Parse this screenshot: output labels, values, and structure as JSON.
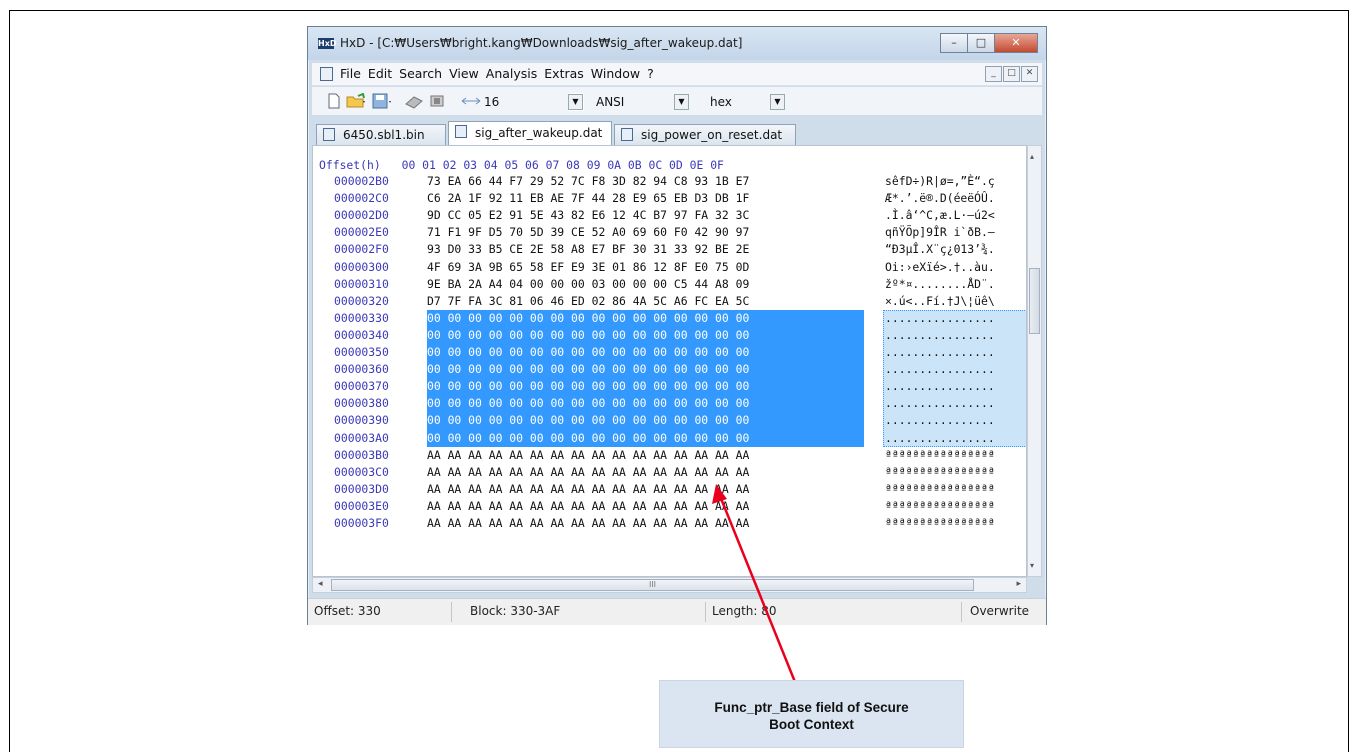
{
  "window": {
    "title": "HxD - [C:₩Users₩bright.kang₩Downloads₩sig_after_wakeup.dat]",
    "app_icon_label": "HxD",
    "controls": {
      "minimize": "–",
      "maximize": "□",
      "close": "✕"
    }
  },
  "menu": {
    "items": [
      "File",
      "Edit",
      "Search",
      "View",
      "Analysis",
      "Extras",
      "Window",
      "?"
    ],
    "mdi_controls": [
      "_",
      "□",
      "✕"
    ]
  },
  "toolbar": {
    "bytes_per_row": "16",
    "charset": "ANSI",
    "offset_base": "hex",
    "icons": [
      "new-file-icon",
      "open-file-icon",
      "save-icon",
      "disk-icon",
      "ram-icon",
      "bytes-per-row-icon"
    ]
  },
  "tabs": [
    {
      "label": "6450.sbl1.bin",
      "active": false
    },
    {
      "label": "sig_after_wakeup.dat",
      "active": true
    },
    {
      "label": "sig_power_on_reset.dat",
      "active": false
    }
  ],
  "editor": {
    "header_label": "Offset(h)",
    "columns": [
      "00",
      "01",
      "02",
      "03",
      "04",
      "05",
      "06",
      "07",
      "08",
      "09",
      "0A",
      "0B",
      "0C",
      "0D",
      "0E",
      "0F"
    ],
    "rows": [
      {
        "offset": "000002B0",
        "hex": "73 EA 66 44 F7 29 52 7C F8 3D 82 94 C8 93 1B E7",
        "ascii": "sêfD÷)R|ø=,”È“.ç",
        "selected": false
      },
      {
        "offset": "000002C0",
        "hex": "C6 2A 1F 92 11 EB AE 7F 44 28 E9 65 EB D3 DB 1F",
        "ascii": "Æ*.’.ë®.D(éeëÓÛ.",
        "selected": false
      },
      {
        "offset": "000002D0",
        "hex": "9D CC 05 E2 91 5E 43 82 E6 12 4C B7 97 FA 32 3C",
        "ascii": ".Ì.â‘^C,æ.L·—ú2<",
        "selected": false
      },
      {
        "offset": "000002E0",
        "hex": "71 F1 9F D5 70 5D 39 CE 52 A0 69 60 F0 42 90 97",
        "ascii": "qñŸÕp]9ÎR i`ðB.—",
        "selected": false
      },
      {
        "offset": "000002F0",
        "hex": "93 D0 33 B5 CE 2E 58 A8 E7 BF 30 31 33 92 BE 2E",
        "ascii": "“Ð3µÎ.X¨ç¿013’¾.",
        "selected": false
      },
      {
        "offset": "00000300",
        "hex": "4F 69 3A 9B 65 58 EF E9 3E 01 86 12 8F E0 75 0D",
        "ascii": "Oi:›eXïé>.†..àu.",
        "selected": false
      },
      {
        "offset": "00000310",
        "hex": "9E BA 2A A4 04 00 00 00 03 00 00 00 C5 44 A8 09",
        "ascii": "žº*¤........ÅD¨.",
        "selected": false
      },
      {
        "offset": "00000320",
        "hex": "D7 7F FA 3C 81 06 46 ED 02 86 4A 5C A6 FC EA 5C",
        "ascii": "×.ú<..Fí.†J\\¦üê\\",
        "selected": false
      },
      {
        "offset": "00000330",
        "hex": "00 00 00 00 00 00 00 00 00 00 00 00 00 00 00 00",
        "ascii": "................",
        "selected": true
      },
      {
        "offset": "00000340",
        "hex": "00 00 00 00 00 00 00 00 00 00 00 00 00 00 00 00",
        "ascii": "................",
        "selected": true
      },
      {
        "offset": "00000350",
        "hex": "00 00 00 00 00 00 00 00 00 00 00 00 00 00 00 00",
        "ascii": "................",
        "selected": true
      },
      {
        "offset": "00000360",
        "hex": "00 00 00 00 00 00 00 00 00 00 00 00 00 00 00 00",
        "ascii": "................",
        "selected": true
      },
      {
        "offset": "00000370",
        "hex": "00 00 00 00 00 00 00 00 00 00 00 00 00 00 00 00",
        "ascii": "................",
        "selected": true
      },
      {
        "offset": "00000380",
        "hex": "00 00 00 00 00 00 00 00 00 00 00 00 00 00 00 00",
        "ascii": "................",
        "selected": true
      },
      {
        "offset": "00000390",
        "hex": "00 00 00 00 00 00 00 00 00 00 00 00 00 00 00 00",
        "ascii": "................",
        "selected": true
      },
      {
        "offset": "000003A0",
        "hex": "00 00 00 00 00 00 00 00 00 00 00 00 00 00 00 00",
        "ascii": "................",
        "selected": true
      },
      {
        "offset": "000003B0",
        "hex": "AA AA AA AA AA AA AA AA AA AA AA AA AA AA AA AA",
        "ascii": "ªªªªªªªªªªªªªªªª",
        "selected": false
      },
      {
        "offset": "000003C0",
        "hex": "AA AA AA AA AA AA AA AA AA AA AA AA AA AA AA AA",
        "ascii": "ªªªªªªªªªªªªªªªª",
        "selected": false
      },
      {
        "offset": "000003D0",
        "hex": "AA AA AA AA AA AA AA AA AA AA AA AA AA AA AA AA",
        "ascii": "ªªªªªªªªªªªªªªªª",
        "selected": false
      },
      {
        "offset": "000003E0",
        "hex": "AA AA AA AA AA AA AA AA AA AA AA AA AA AA AA AA",
        "ascii": "ªªªªªªªªªªªªªªªª",
        "selected": false
      },
      {
        "offset": "000003F0",
        "hex": "AA AA AA AA AA AA AA AA AA AA AA AA AA AA AA AA",
        "ascii": "ªªªªªªªªªªªªªªªª",
        "selected": false
      }
    ]
  },
  "scrollbar": {
    "hthumb_grip": "III",
    "left_arrow": "◂",
    "right_arrow": "▸",
    "up_arrow": "▴",
    "down_arrow": "▾"
  },
  "status": {
    "offset": "Offset: 330",
    "block": "Block: 330-3AF",
    "length": "Length: 80",
    "mode": "Overwrite"
  },
  "callout": {
    "line1": "Func_ptr_Base  field of Secure",
    "line2": "Boot Context"
  },
  "colors": {
    "selection": "#3399ff",
    "arrow": "#e8001c",
    "offset_text": "#3b38b8",
    "callout_bg": "#dbe5f1"
  }
}
